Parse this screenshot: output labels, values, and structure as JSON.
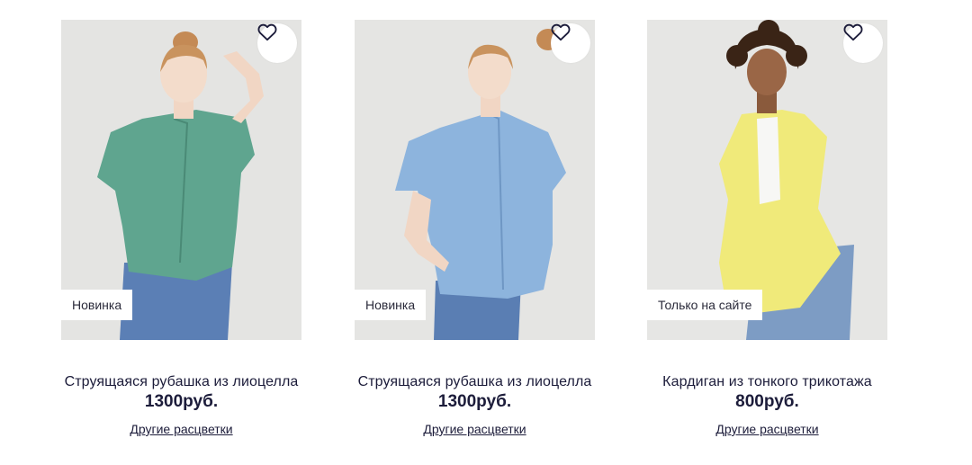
{
  "products": [
    {
      "title": "Струящаяся рубашка из лиоцелла",
      "price": "1300руб.",
      "badge": "Новинка",
      "other_colors": "Другие расцветки",
      "garment_color": "#5fa58f"
    },
    {
      "title": "Струящаяся рубашка из лиоцелла",
      "price": "1300руб.",
      "badge": "Новинка",
      "other_colors": "Другие расцветки",
      "garment_color": "#8db4dd"
    },
    {
      "title": "Кардиган из тонкого трикотажа",
      "price": "800руб.",
      "badge": "Только на сайте",
      "other_colors": "Другие расцветки",
      "garment_color": "#f0ea7a"
    }
  ],
  "icons": {
    "favorite": "heart-icon"
  }
}
